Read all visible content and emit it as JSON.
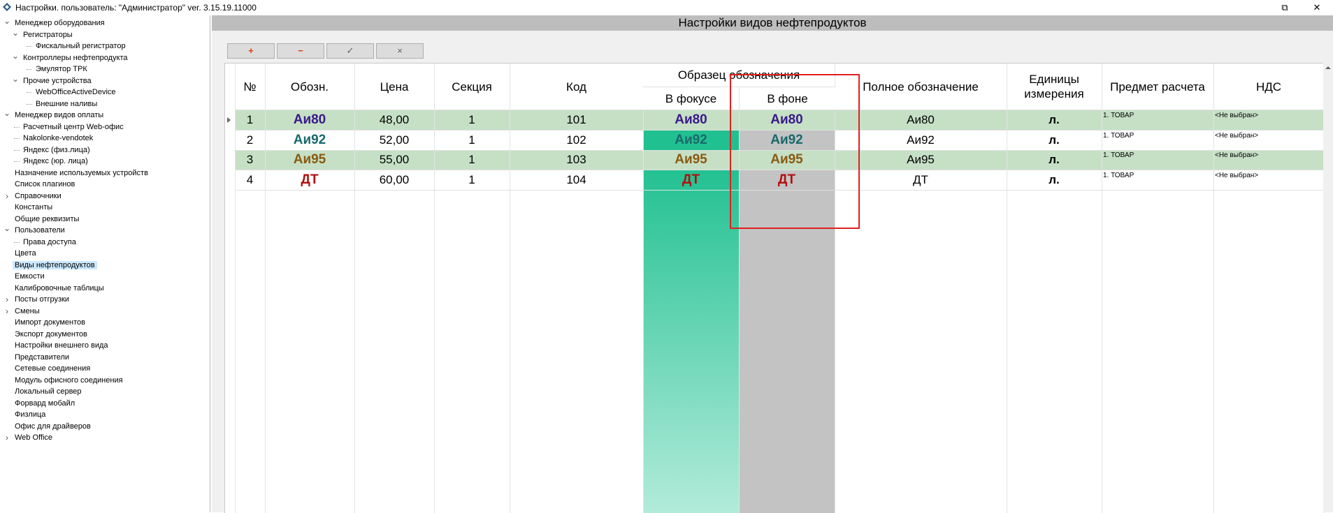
{
  "window": {
    "title": "Настройки. пользователь: \"Администратор\" ver. 3.15.19.11000",
    "restore_glyph": "⧉",
    "close_glyph": "✕"
  },
  "tree": [
    {
      "label": "Менеджер оборудования",
      "expanded": true
    },
    {
      "label": "Регистраторы",
      "expanded": true
    },
    {
      "label": "Фискальный регистратор"
    },
    {
      "label": "Контроллеры нефтепродукта",
      "expanded": true
    },
    {
      "label": "Эмулятор ТРК"
    },
    {
      "label": "Прочие устройства",
      "expanded": true
    },
    {
      "label": "WebOfficeActiveDevice"
    },
    {
      "label": "Внешние наливы"
    },
    {
      "label": "Менеджер видов оплаты",
      "expanded": true
    },
    {
      "label": "Расчетный центр Web-офис"
    },
    {
      "label": "Nakolonke-vendotek"
    },
    {
      "label": "Яндекс (физ.лица)"
    },
    {
      "label": "Яндекс (юр. лица)"
    },
    {
      "label": "Назначение используемых устройств"
    },
    {
      "label": "Список плагинов"
    },
    {
      "label": "Справочники",
      "expanded": false
    },
    {
      "label": "Константы"
    },
    {
      "label": "Общие реквизиты"
    },
    {
      "label": "Пользователи",
      "expanded": true
    },
    {
      "label": "Права доступа"
    },
    {
      "label": "Цвета"
    },
    {
      "label": "Виды нефтепродуктов",
      "selected": true
    },
    {
      "label": "Емкости"
    },
    {
      "label": "Калибровочные таблицы"
    },
    {
      "label": "Посты отгрузки",
      "expanded": false
    },
    {
      "label": "Смены",
      "expanded": false
    },
    {
      "label": "Импорт документов"
    },
    {
      "label": "Экспорт документов"
    },
    {
      "label": "Настройки внешнего вида"
    },
    {
      "label": "Представители"
    },
    {
      "label": "Сетевые соединения"
    },
    {
      "label": "Модуль офисного соединения"
    },
    {
      "label": "Локальный сервер"
    },
    {
      "label": "Форвард мобайл"
    },
    {
      "label": "Физлица"
    },
    {
      "label": "Офис для драйверов"
    },
    {
      "label": "Web Office",
      "expanded": false
    }
  ],
  "panel": {
    "title": "Настройки видов нефтепродуктов"
  },
  "toolbar": {
    "add": {
      "glyph": "+",
      "color": "#e04010"
    },
    "remove": {
      "glyph": "−",
      "color": "#e04010"
    },
    "confirm": {
      "glyph": "✓",
      "color": "#606060"
    },
    "cancel": {
      "glyph": "×",
      "color": "#606060"
    }
  },
  "grid": {
    "headers": {
      "num": "№",
      "abbr": "Обозн.",
      "price": "Цена",
      "section": "Секция",
      "code": "Код",
      "sample": "Образец обозначения",
      "focus": "В фокусе",
      "background": "В фоне",
      "full_name": "Полное обозначение",
      "unit": "Единицы измерения",
      "subject": "Предмет расчета",
      "vat": "НДС"
    },
    "rows": [
      {
        "num": "1",
        "abbr": "Аи80",
        "color": "#3a1a8a",
        "price": "48,00",
        "section": "1",
        "code": "101",
        "full_name": "Аи80",
        "unit": "л.",
        "subject": "1. ТОВАР",
        "vat": "<Не выбран>",
        "banded": true
      },
      {
        "num": "2",
        "abbr": "Аи92",
        "color": "#1a6a6a",
        "price": "52,00",
        "section": "1",
        "code": "102",
        "full_name": "Аи92",
        "unit": "л.",
        "subject": "1. ТОВАР",
        "vat": "<Не выбран>",
        "banded": false
      },
      {
        "num": "3",
        "abbr": "Аи95",
        "color": "#8a5a10",
        "price": "55,00",
        "section": "1",
        "code": "103",
        "full_name": "Аи95",
        "unit": "л.",
        "subject": "1. ТОВАР",
        "vat": "<Не выбран>",
        "banded": true
      },
      {
        "num": "4",
        "abbr": "ДТ",
        "color": "#b01010",
        "price": "60,00",
        "section": "1",
        "code": "104",
        "full_name": "ДТ",
        "unit": "л.",
        "subject": "1. ТОВАР",
        "vat": "<Не выбран>",
        "banded": false
      }
    ]
  },
  "colors": {
    "row_band": "#c6e0c6",
    "focus_column_top": "#20c090",
    "focus_column_bottom": "#b2ebda",
    "background_column": "#c3c3c3",
    "highlight": "#e02020",
    "selected_tree": "#cce8ff"
  }
}
